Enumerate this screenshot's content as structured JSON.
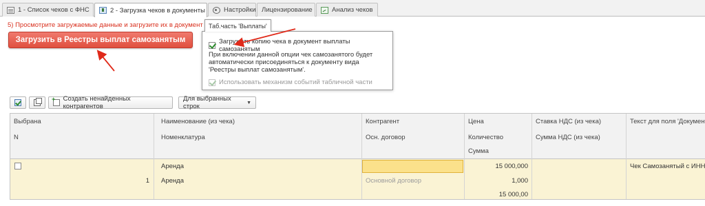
{
  "tabs": [
    {
      "label": "1 - Список чеков с ФНС",
      "icon": "list-icon"
    },
    {
      "label": "2 - Загрузка чеков в документы",
      "icon": "upload-icon"
    },
    {
      "label": "Настройки",
      "icon": "gear-icon"
    },
    {
      "label": "Лицензирование",
      "icon": ""
    },
    {
      "label": "Анализ чеков",
      "icon": "analysis-icon"
    }
  ],
  "instruction": "5) Просмотрите загружаемые данные и загрузите их в документ",
  "main_button": "Загрузить в Реестры выплат самозанятым",
  "popup": {
    "tab_label": "Таб.часть 'Выплаты'",
    "option1": "Загружать копию чека в документ выплаты самозанятым",
    "description": "При включении данной опции чек самозанятого будет автоматически присоединяться к документу вида 'Реестры выплат самозанятым'.",
    "option2": "Использовать механизм событий табличной части"
  },
  "toolbar": {
    "create_label": "Создать ненайденных контрагентов",
    "selected_rows_label": "Для выбранных строк"
  },
  "table": {
    "headers": {
      "col1_r1": "Выбрана",
      "col1_r2": "N",
      "col2_r1": "Наименование (из чека)",
      "col2_r2": "Номенклатура",
      "col3_r1": "Контрагент",
      "col3_r2": "Осн. договор",
      "col4_r1": "Цена",
      "col4_r2": "Количество",
      "col4_r3": "Сумма",
      "col5_r1": "Ставка НДС (из чека)",
      "col5_r2": "Сумма НДС (из чека)",
      "col6_r1": "Текст для поля 'Документ"
    },
    "row": {
      "name": "Аренда",
      "price": "15 000,000",
      "receipt_text": "Чек Самозанятый с ИНН",
      "n": "1",
      "nomenclature": "Аренда",
      "contract": "Основной договор",
      "quantity": "1,000",
      "sum": "15 000,00"
    }
  },
  "colors": {
    "accent_button": "#e0503f",
    "instruction_text": "#d9301e",
    "row_highlight": "#faf3d4",
    "arrow": "#e02a1a"
  }
}
